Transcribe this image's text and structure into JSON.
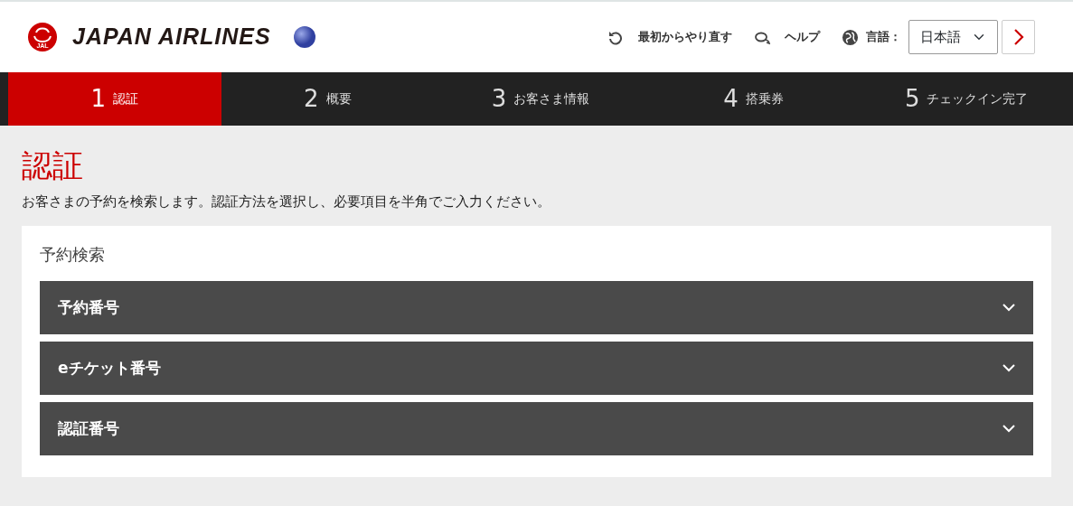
{
  "header": {
    "brand": "JAPAN AIRLINES",
    "emblem_text": "JAL",
    "actions": [
      {
        "kind": "restart",
        "label": "最初からやり直す"
      },
      {
        "kind": "help",
        "label": "ヘルプ"
      }
    ],
    "language": {
      "label": "言語：",
      "value": "日本語"
    }
  },
  "steps": [
    {
      "number": "1",
      "label": "認証",
      "selected": true
    },
    {
      "number": "2",
      "label": "概要",
      "selected": false
    },
    {
      "number": "3",
      "label": "お客さま情報",
      "selected": false
    },
    {
      "number": "4",
      "label": "搭乗券",
      "selected": false
    },
    {
      "number": "5",
      "label": "チェックイン完了",
      "selected": false
    }
  ],
  "page": {
    "title": "認証",
    "description": "お客さまの予約を検索します。認証方法を選択し、必要項目を半角でご入力ください。"
  },
  "search": {
    "title": "予約検索",
    "methods": [
      {
        "label": "予約番号",
        "expanded": false
      },
      {
        "label": "eチケット番号",
        "expanded": false
      },
      {
        "label": "認証番号",
        "expanded": false
      }
    ]
  }
}
